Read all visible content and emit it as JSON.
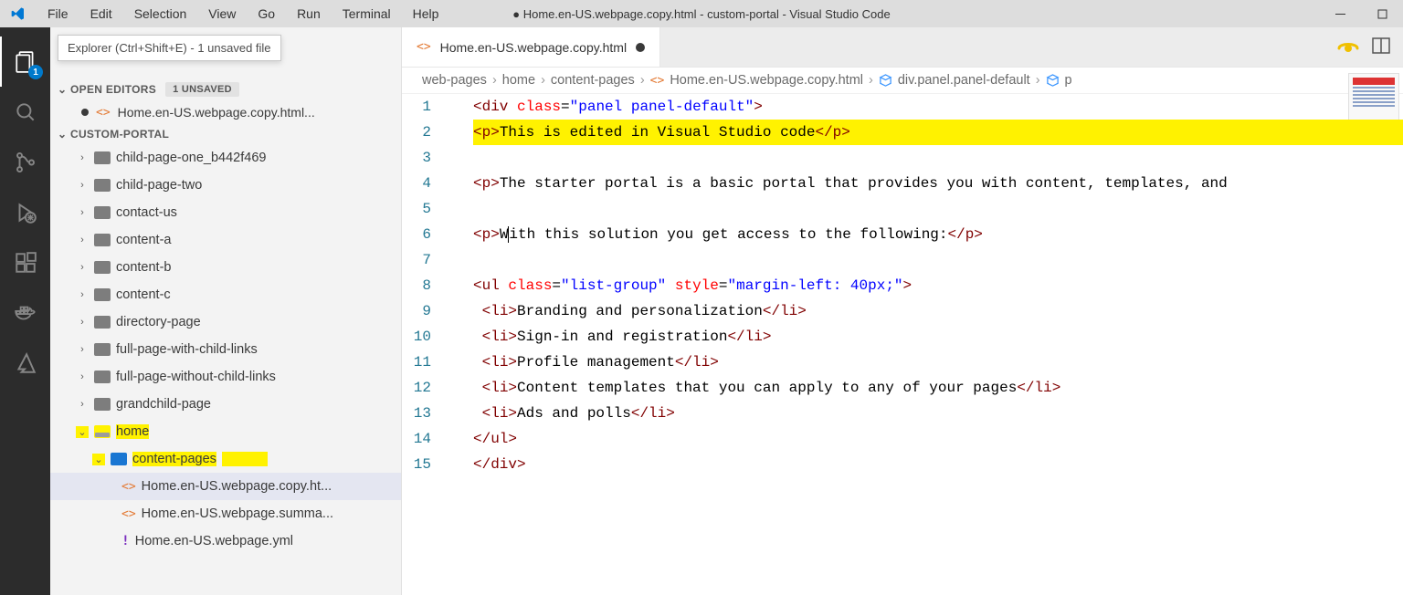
{
  "titlebar": {
    "menus": [
      "File",
      "Edit",
      "Selection",
      "View",
      "Go",
      "Run",
      "Terminal",
      "Help"
    ],
    "title": "● Home.en-US.webpage.copy.html - custom-portal - Visual Studio Code"
  },
  "activitybar": {
    "explorer_badge": "1"
  },
  "explorer": {
    "tooltip": "Explorer (Ctrl+Shift+E) - 1 unsaved file",
    "open_editors_label": "OPEN EDITORS",
    "unsaved_pill": "1 UNSAVED",
    "open_file": "Home.en-US.webpage.copy.html...",
    "workspace_label": "CUSTOM-PORTAL",
    "tree": {
      "child_page_one": "child-page-one_b442f469",
      "child_page_two": "child-page-two",
      "contact_us": "contact-us",
      "content_a": "content-a",
      "content_b": "content-b",
      "content_c": "content-c",
      "directory_page": "directory-page",
      "full_page_with": "full-page-with-child-links",
      "full_page_without": "full-page-without-child-links",
      "grandchild_page": "grandchild-page",
      "home": "home",
      "content_pages": "content-pages",
      "file_copy": "Home.en-US.webpage.copy.ht...",
      "file_summa": "Home.en-US.webpage.summa...",
      "file_yml": "Home.en-US.webpage.yml"
    }
  },
  "tabs": {
    "open": "Home.en-US.webpage.copy.html"
  },
  "breadcrumb": {
    "p0": "web-pages",
    "p1": "home",
    "p2": "content-pages",
    "p3": "Home.en-US.webpage.copy.html",
    "p4": "div.panel.panel-default",
    "p5": "p"
  },
  "code": {
    "l1a": "<div ",
    "l1b": "class",
    "l1c": "=",
    "l1d": "\"panel panel-default\"",
    "l1e": ">",
    "l2a": "<p>",
    "l2b": "This is edited in Visual Studio code",
    "l2c": "</p>",
    "l4a": "<p>",
    "l4b": "The starter portal is a basic portal that provides you with content, templates, and",
    "l4c": "",
    "l6a": "<p>",
    "l6b": "W",
    "l6c": "ith this solution you get access to the following:",
    "l6d": "</p>",
    "l8a": "<ul ",
    "l8b": "class",
    "l8c": "=",
    "l8d": "\"list-group\"",
    "l8e": " ",
    "l8f": "style",
    "l8g": "=",
    "l8h": "\"margin-left: 40px;\"",
    "l8i": ">",
    "l9a": "<li>",
    "l9b": "Branding and personalization",
    "l9c": "</li>",
    "l10a": "<li>",
    "l10b": "Sign-in and registration",
    "l10c": "</li>",
    "l11a": "<li>",
    "l11b": "Profile management",
    "l11c": "</li>",
    "l12a": "<li>",
    "l12b": "Content templates that you can apply to any of your pages",
    "l12c": "</li>",
    "l13a": "<li>",
    "l13b": "Ads and polls",
    "l13c": "</li>",
    "l14": "</ul>",
    "l15": "</div>"
  },
  "lines": [
    "1",
    "2",
    "3",
    "4",
    "5",
    "6",
    "7",
    "8",
    "9",
    "10",
    "11",
    "12",
    "13",
    "14",
    "15"
  ]
}
